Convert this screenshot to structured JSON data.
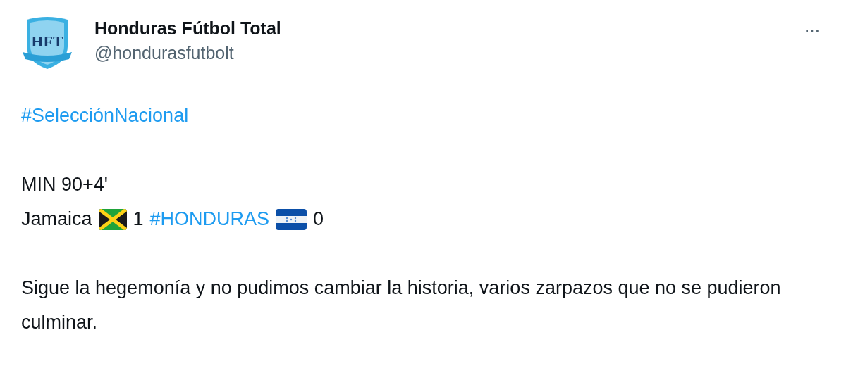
{
  "author": {
    "avatar_text": "HFT",
    "name": "Honduras Fútbol Total",
    "handle": "@hondurasfutbolt"
  },
  "more_button": "···",
  "body": [
    {
      "kind": "line",
      "segments": [
        {
          "kind": "hashtag",
          "text": "#SelecciónNacional"
        }
      ]
    },
    {
      "kind": "gap"
    },
    {
      "kind": "line",
      "segments": [
        {
          "kind": "text",
          "text": "MIN 90+4'"
        }
      ]
    },
    {
      "kind": "line",
      "segments": [
        {
          "kind": "text",
          "text": "Jamaica"
        },
        {
          "kind": "flag-jamaica"
        },
        {
          "kind": "text",
          "text": "1"
        },
        {
          "kind": "hashtag",
          "text": "#HONDURAS"
        },
        {
          "kind": "flag-honduras"
        },
        {
          "kind": "text",
          "text": "0"
        }
      ]
    },
    {
      "kind": "gap"
    },
    {
      "kind": "paragraph",
      "text": "Sigue la hegemonía y no pudimos cambiar la historia, varios zarpazos que no se pudieron culminar."
    }
  ]
}
